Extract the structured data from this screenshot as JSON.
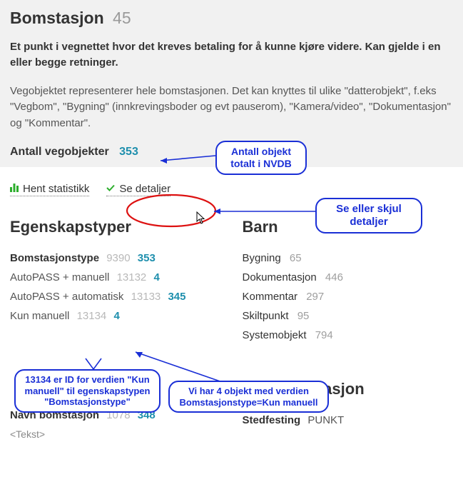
{
  "header": {
    "title": "Bomstasjon",
    "type_id": "45",
    "description_bold": "Et punkt i vegnettet hvor det kreves betaling for å kunne kjøre videre. Kan gjelde i en eller begge retninger.",
    "description_plain": "Vegobjektet representerer hele bomstasjonen. Det kan knyttes til ulike \"datterobjekt\", f.eks \"Vegbom\", \"Bygning\" (innkrevingsboder og evt pauserom), \"Kamera/video\", \"Dokumentasjon\" og \"Kommentar\".",
    "count_label": "Antall vegobjekter",
    "count_value": "353"
  },
  "toolbar": {
    "stats_label": "Hent statistikk",
    "details_label": "Se detaljer"
  },
  "sections": {
    "props_heading": "Egenskapstyper",
    "children_heading": "Barn",
    "more_heading": "Mer informasjon"
  },
  "props": [
    {
      "label": "Bomstasjonstype",
      "id": "9390",
      "count": "353",
      "sub": false
    },
    {
      "label": "AutoPASS + manuell",
      "id": "13132",
      "count": "4",
      "sub": true
    },
    {
      "label": "AutoPASS + automatisk",
      "id": "13133",
      "count": "345",
      "sub": true
    },
    {
      "label": "Kun manuell",
      "id": "13134",
      "count": "4",
      "sub": true
    }
  ],
  "navn_bomstasjon": {
    "label": "Navn bomstasjon",
    "id": "1078",
    "count": "348",
    "type": "<Tekst>"
  },
  "children": [
    {
      "label": "Bygning",
      "count": "65"
    },
    {
      "label": "Dokumentasjon",
      "count": "446"
    },
    {
      "label": "Kommentar",
      "count": "297"
    },
    {
      "label": "Skiltpunkt",
      "count": "95"
    },
    {
      "label": "Systemobjekt",
      "count": "794"
    }
  ],
  "stedfesting": {
    "label": "Stedfesting",
    "value": "PUNKT"
  },
  "callouts": {
    "c1": "Antall objekt\ntotalt i NVDB",
    "c2": "Se eller skjul\ndetaljer",
    "c3": "13134 er ID for verdien \"Kun manuell\" til egenskapstypen \"Bomstasjonstype\"",
    "c4": "Vi har 4 objekt med verdien Bomstasjonstype=Kun manuell"
  }
}
